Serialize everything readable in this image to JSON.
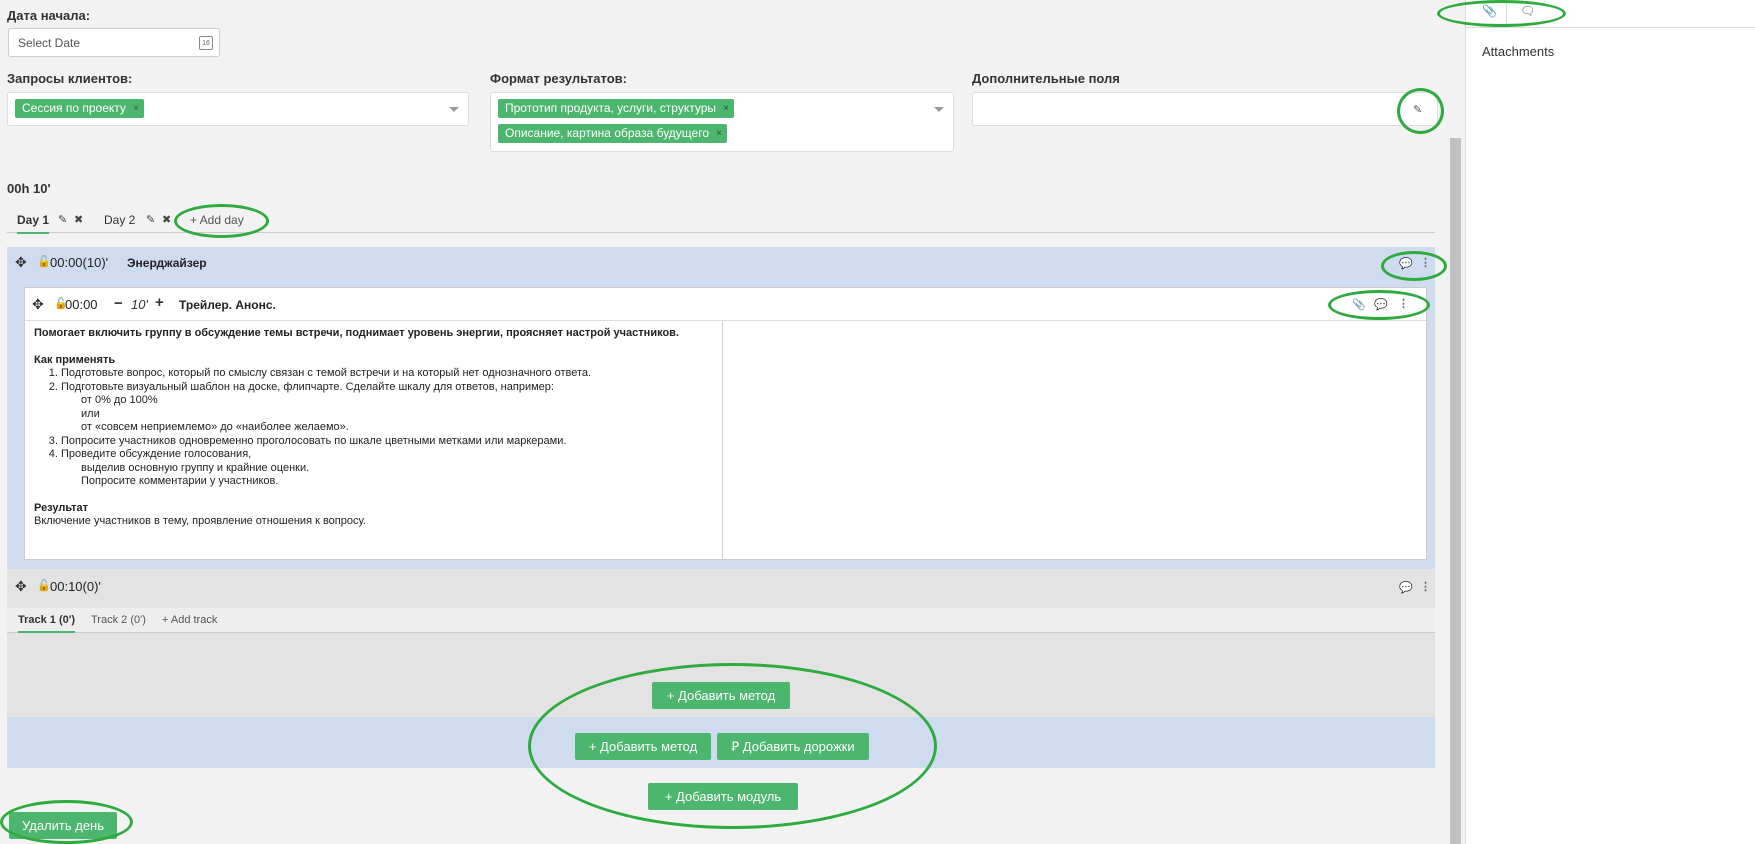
{
  "form": {
    "start_date_label": "Дата начала:",
    "start_date_placeholder": "Select Date",
    "calendar_icon_text": "16",
    "client_requests_label": "Запросы клиентов:",
    "client_requests_tags": [
      "Сессия по проекту"
    ],
    "result_format_label": "Формат результатов:",
    "result_format_tags": [
      "Прототип продукта, услуги, структуры",
      "Описание, картина образа будущего"
    ],
    "extra_fields_label": "Дополнительные поля"
  },
  "duration": "00h 10'",
  "day_tabs": [
    {
      "label": "Day 1",
      "active": true
    },
    {
      "label": "Day 2",
      "active": false
    }
  ],
  "add_day_label": "+ Add day",
  "module1": {
    "time": "00:00(10)'",
    "title": "Энерджайзер",
    "method": {
      "time": "00:00",
      "duration": "10'",
      "title": "Трейлер. Анонс.",
      "intro": "Помогает включить группу в обсуждение темы встречи, поднимает уровень энергии, проясняет настрой участников.",
      "how_title": "Как применять",
      "steps": [
        "Подготовьте вопрос, который по смыслу связан с темой встречи и на который нет однозначного ответа.",
        "Подготовьте визуальный шаблон на доске, флипчарте. Сделайте шкалу для ответов, например:",
        "Попросите участников одновременно проголосовать по шкале цветными метками или маркерами.",
        "Проведите обсуждение голосования,"
      ],
      "step2_extra": [
        "от 0% до 100%",
        "или",
        "от «совсем неприемлемо» до «наиболее желаемо»."
      ],
      "step4_extra": [
        "выделив основную группу и крайние оценки.",
        "Попросите комментарии у участников."
      ],
      "result_title": "Результат",
      "result_text": "Включение участников в тему, проявление отношения к вопросу."
    }
  },
  "module2": {
    "time": "00:10(0)'",
    "tracks": [
      {
        "label": "Track 1 (0')",
        "active": true
      },
      {
        "label": "Track 2 (0')",
        "active": false
      }
    ],
    "add_track_label": "+ Add track"
  },
  "buttons": {
    "add_method_1": "+ Добавить метод",
    "add_method_2": "+ Добавить метод",
    "add_tracks": "Ꝑ Добавить дорожки",
    "add_module": "+ Добавить модуль",
    "delete_day": "Удалить день"
  },
  "right_panel": {
    "title": "Attachments"
  },
  "colors": {
    "accent": "#4cb56e",
    "module_blue": "#cfdcef",
    "annotation_ring": "#2eaa3f"
  }
}
